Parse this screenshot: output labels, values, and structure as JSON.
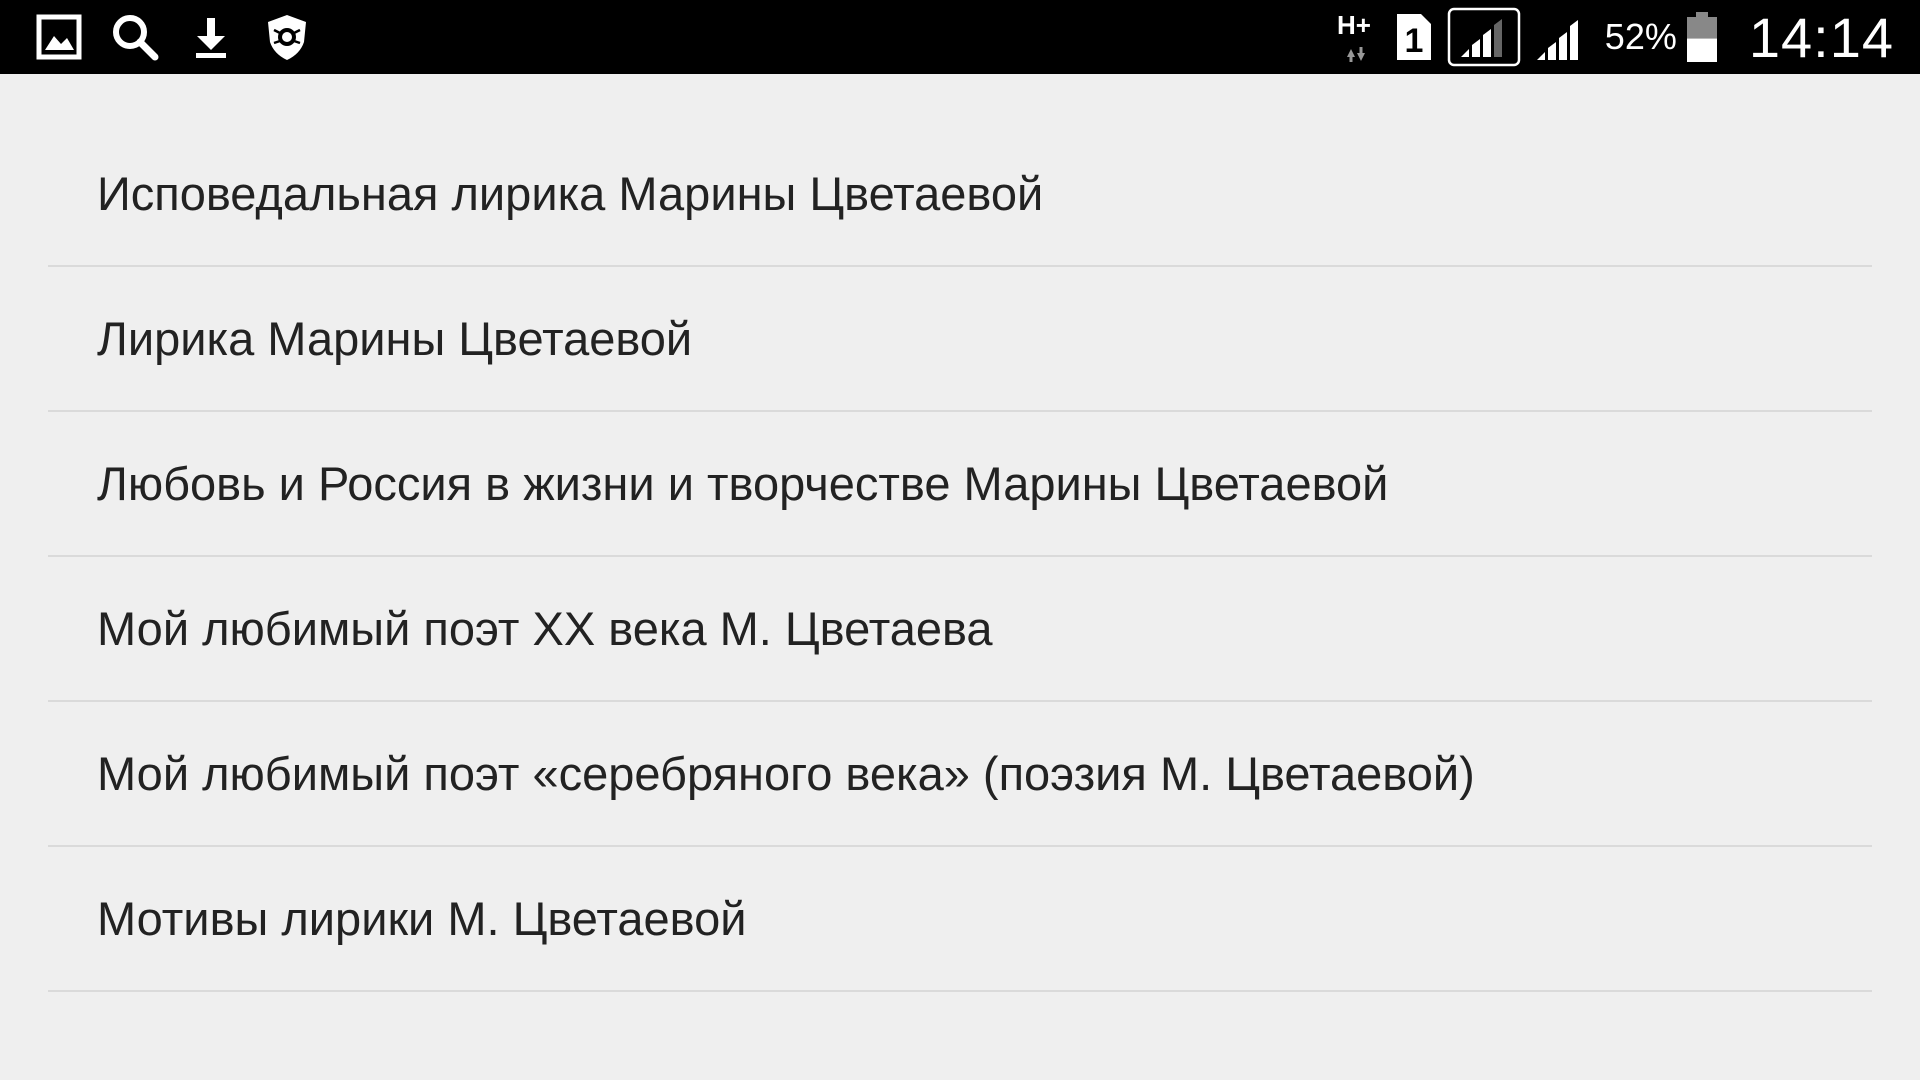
{
  "status_bar": {
    "left_icons": [
      "gallery-icon",
      "search-icon",
      "download-icon",
      "antivirus-shield-icon"
    ],
    "network_type": "H+",
    "sim_slot": "1",
    "battery_percent": "52%",
    "battery_level": 0.52,
    "time": "14:14"
  },
  "list": {
    "items": [
      {
        "label": "Исповедальная лирика Марины Цветаевой"
      },
      {
        "label": "Лирика Марины Цветаевой"
      },
      {
        "label": "Любовь и Россия в жизни и творчестве Марины Цветаевой"
      },
      {
        "label": "Мой любимый поэт XX века М. Цветаева"
      },
      {
        "label": "Мой любимый поэт «серебряного века» (поэзия М. Цветаевой)"
      },
      {
        "label": "Мотивы лирики М. Цветаевой"
      }
    ]
  }
}
